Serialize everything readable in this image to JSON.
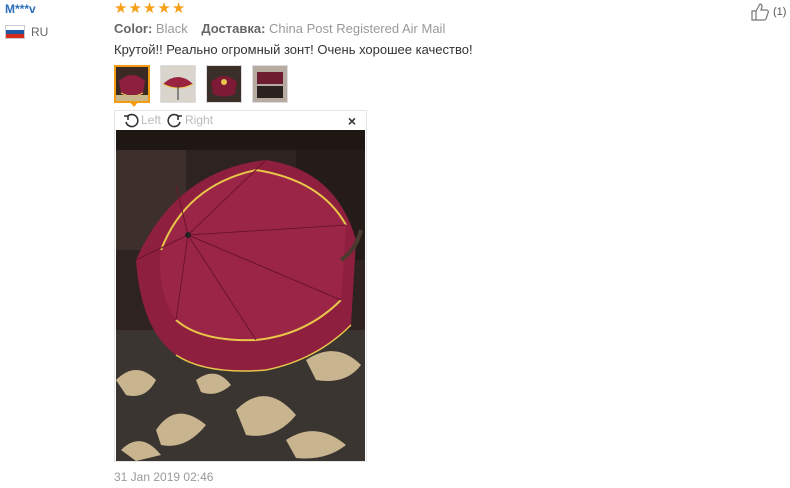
{
  "reviewer": {
    "name": "M***v",
    "country_code": "RU",
    "flag_colors": [
      "#ffffff",
      "#1c57a5",
      "#d52b1e"
    ]
  },
  "review": {
    "rating": 5,
    "color_label": "Color:",
    "color_value": "Black",
    "shipping_label": "Доставка:",
    "shipping_value": "China Post Registered Air Mail",
    "text": "Крутой!! Реально огромный зонт! Очень хорошее качество!",
    "date": "31 Jan 2019 02:46",
    "helpful_count": "(1)"
  },
  "viewer": {
    "rotate_left_label": "Left",
    "rotate_right_label": "Right",
    "close_glyph": "×"
  },
  "thumbnails": [
    {
      "name": "photo-1",
      "active": true
    },
    {
      "name": "photo-2",
      "active": false
    },
    {
      "name": "photo-3",
      "active": false
    },
    {
      "name": "photo-4",
      "active": false
    }
  ],
  "colors": {
    "star": "#f6a01a",
    "username": "#2a6ebb",
    "active_thumb_border": "#f39c12",
    "umbrella": "#8e1f3e",
    "umbrella_trim": "#e8c64a"
  }
}
